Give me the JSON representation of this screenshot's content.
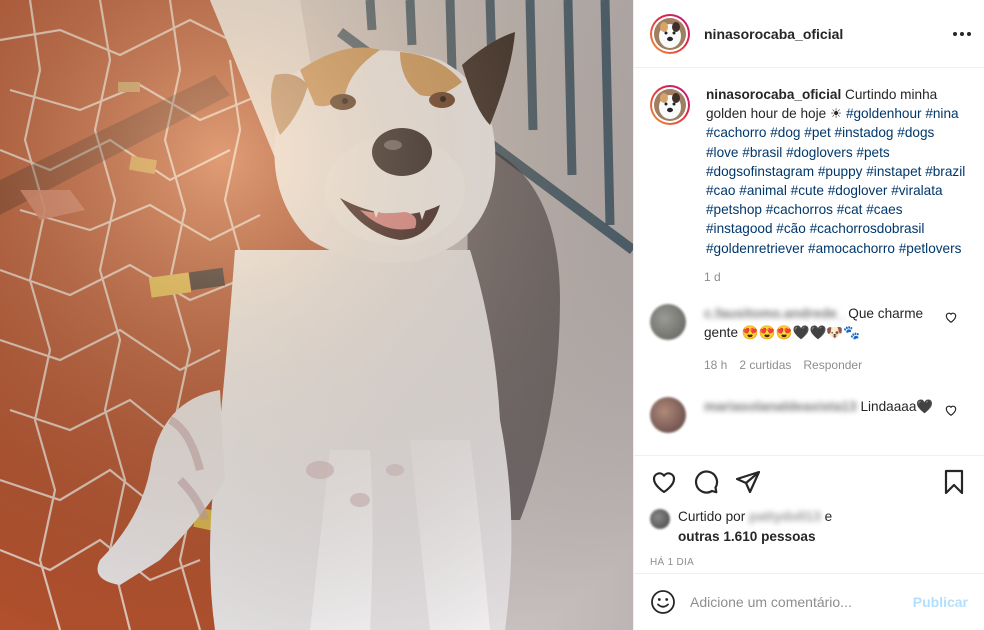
{
  "post": {
    "username": "ninasorocaba_oficial",
    "caption_text": "Curtindo minha golden hour de hoje ☀",
    "hashtags": [
      "#goldenhour",
      "#nina",
      "#cachorro",
      "#dog",
      "#pet",
      "#instadog",
      "#dogs",
      "#love",
      "#brasil",
      "#doglovers",
      "#pets",
      "#dogsofinstagram",
      "#puppy",
      "#instapet",
      "#brazil",
      "#cao",
      "#animal",
      "#cute",
      "#doglover",
      "#viralata",
      "#petshop",
      "#cachorros",
      "#cat",
      "#caes",
      "#instagood",
      "#cão",
      "#cachorrosdobrasil",
      "#goldenretriever",
      "#amocachorro",
      "#petlovers"
    ],
    "time": "1 d"
  },
  "comments": [
    {
      "user": "c.fausitomo.andrede_",
      "text": "Que charme gente 😍😍😍🖤🖤🐶🐾",
      "time": "18 h",
      "likes": "2 curtidas",
      "reply": "Responder"
    },
    {
      "user": "mariasolanaldeaxista13",
      "text": "Lindaaaa🖤",
      "time": "",
      "likes": "",
      "reply": ""
    }
  ],
  "likes": {
    "prefix": "Curtido por",
    "user": "pattydoll13",
    "suffix": "e",
    "others": "outras 1.610 pessoas"
  },
  "date": "HÁ 1 DIA",
  "add_comment": {
    "placeholder": "Adicione um comentário...",
    "publish": "Publicar"
  },
  "icons": {
    "like": "heart-outline-icon",
    "comment": "comment-bubble-icon",
    "share": "paper-plane-icon",
    "save": "bookmark-icon",
    "emoji": "smiley-icon",
    "more": "three-dots-icon"
  },
  "colors": {
    "text": "#262626",
    "muted": "#8e8e8e",
    "hashtag": "#00376b",
    "publish_disabled": "#b2dffc",
    "border": "#efefef"
  }
}
